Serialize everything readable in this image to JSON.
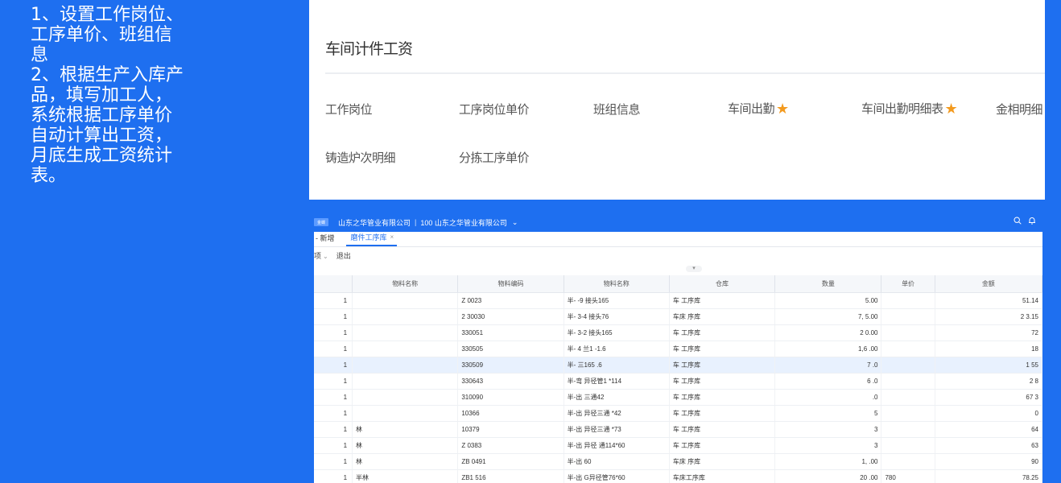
{
  "notes": [
    "1、设置工作岗位、\n工序单价、班组信\n息",
    "2、根据生产入库产\n品，填写加工人，\n系统根据工序单价\n自动计算出工资，\n月底生成工资统计\n表。"
  ],
  "card": {
    "title": "车间计件工资",
    "menu": [
      {
        "label": "工作岗位",
        "star": false
      },
      {
        "label": "工序岗位单价",
        "star": false
      },
      {
        "label": "班组信息",
        "star": false
      },
      {
        "label": "车间出勤",
        "star": true
      },
      {
        "label": "车间出勤明细表",
        "star": true
      },
      {
        "label": "金相明细",
        "star": false
      },
      {
        "label": "铸造炉次明细",
        "star": false
      },
      {
        "label": "分拣工序单价",
        "star": false
      }
    ],
    "star_color": "#f39a1e"
  },
  "app": {
    "logo_text": "金蝶",
    "company": "山东之华管业有限公司",
    "separator": "|",
    "org": "100 山东之华管业有限公司",
    "org_caret": "⌄",
    "icons": [
      "search-icon",
      "bell-icon"
    ],
    "tabs": {
      "new": "- 新增",
      "active": "磨件工序库",
      "close": "×"
    },
    "toolbar": {
      "item1": "项",
      "item2": "退出"
    },
    "collapse": "▾",
    "columns": [
      "",
      "物料名称",
      "物料编码",
      "物料名称",
      "仓库",
      "数量",
      "单价",
      "金额"
    ],
    "rows": [
      {
        "idx": "1",
        "name": "",
        "code": "Z 0023",
        "mat": "半- -9 接头165",
        "wh": "车 工序库",
        "qty": "5.00",
        "price": "",
        "amt": "51.14"
      },
      {
        "idx": "1",
        "name": "",
        "code": "2 30030",
        "mat": "半- 3-4 接头76",
        "wh": "车床 序库",
        "qty": "7, 5.00",
        "price": "",
        "amt": "2 3.15"
      },
      {
        "idx": "1",
        "name": "",
        "code": "330051",
        "mat": "半- 3-2 接头165",
        "wh": "车 工序库",
        "qty": "2 0.00",
        "price": "",
        "amt": "72"
      },
      {
        "idx": "1",
        "name": "",
        "code": "330505",
        "mat": "半- 4 兰1 -1.6",
        "wh": "车 工序库",
        "qty": "1,6 .00",
        "price": "",
        "amt": "18"
      },
      {
        "idx": "1",
        "name": "",
        "code": "330509",
        "mat": "半- 三165 .6",
        "wh": "车 工序库",
        "qty": "7 .0",
        "price": "",
        "amt": "1 55"
      },
      {
        "idx": "1",
        "name": "",
        "code": "330643",
        "mat": "半-弯 异径管1 *114",
        "wh": "车 工序库",
        "qty": "6 .0",
        "price": "",
        "amt": "2 8"
      },
      {
        "idx": "1",
        "name": "",
        "code": "310090",
        "mat": "半-出 三通42",
        "wh": "车 工序库",
        "qty": ".0",
        "price": "",
        "amt": "67 3"
      },
      {
        "idx": "1",
        "name": "",
        "code": "10366",
        "mat": "半-出 异径三通 *42",
        "wh": "车 工序库",
        "qty": "5",
        "price": "",
        "amt": "0"
      },
      {
        "idx": "1",
        "name": "林",
        "code": "10379",
        "mat": "半-出 异径三通 *73",
        "wh": "车 工序库",
        "qty": "3",
        "price": "",
        "amt": "64"
      },
      {
        "idx": "1",
        "name": "林",
        "code": "Z 0383",
        "mat": "半-出 异径 通114*60",
        "wh": "车 工序库",
        "qty": "3",
        "price": "",
        "amt": "63"
      },
      {
        "idx": "1",
        "name": "林",
        "code": "ZB 0491",
        "mat": "半-出 60",
        "wh": "车床 序库",
        "qty": "1, .00",
        "price": "",
        "amt": "90"
      },
      {
        "idx": "1",
        "name": "半林",
        "code": "ZB1 516",
        "mat": "半-出 G异径管76*60",
        "wh": "车床工序库",
        "qty": "20 .00",
        "price": "780",
        "amt": "78.25"
      }
    ],
    "selected_row": 4
  }
}
